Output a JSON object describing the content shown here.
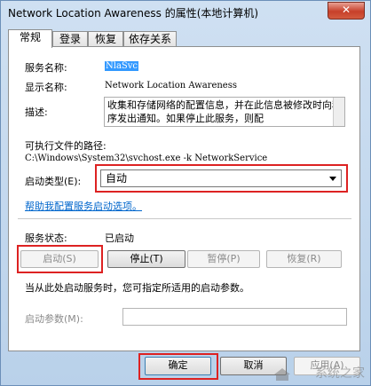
{
  "window": {
    "title": "Network Location Awareness 的属性(本地计算机)",
    "close_glyph": "✕"
  },
  "tabs": [
    {
      "label": "常规",
      "active": true
    },
    {
      "label": "登录",
      "active": false
    },
    {
      "label": "恢复",
      "active": false
    },
    {
      "label": "依存关系",
      "active": false
    }
  ],
  "general": {
    "service_name_label": "服务名称:",
    "service_name_value": "NlaSvc",
    "display_name_label": "显示名称:",
    "display_name_value": "Network Location Awareness",
    "description_label": "描述:",
    "description_value": "收集和存储网络的配置信息，并在此信息被修改时向程序发出通知。如果停止此服务，则配",
    "exe_path_label": "可执行文件的路径:",
    "exe_path_value": "C:\\Windows\\System32\\svchost.exe -k NetworkService",
    "startup_type_label": "启动类型(E):",
    "startup_type_value": "自动",
    "help_link": "帮助我配置服务启动选项。",
    "service_status_label": "服务状态:",
    "service_status_value": "已启动",
    "buttons": {
      "start": "启动(S)",
      "stop": "停止(T)",
      "pause": "暂停(P)",
      "resume": "恢复(R)"
    },
    "hint": "当从此处启动服务时，您可指定所适用的启动参数。",
    "start_params_label": "启动参数(M):",
    "start_params_value": ""
  },
  "footer": {
    "ok": "确定",
    "cancel": "取消",
    "apply": "应用(A)"
  },
  "watermark": "系统之家",
  "highlight_color": "#dd2222"
}
